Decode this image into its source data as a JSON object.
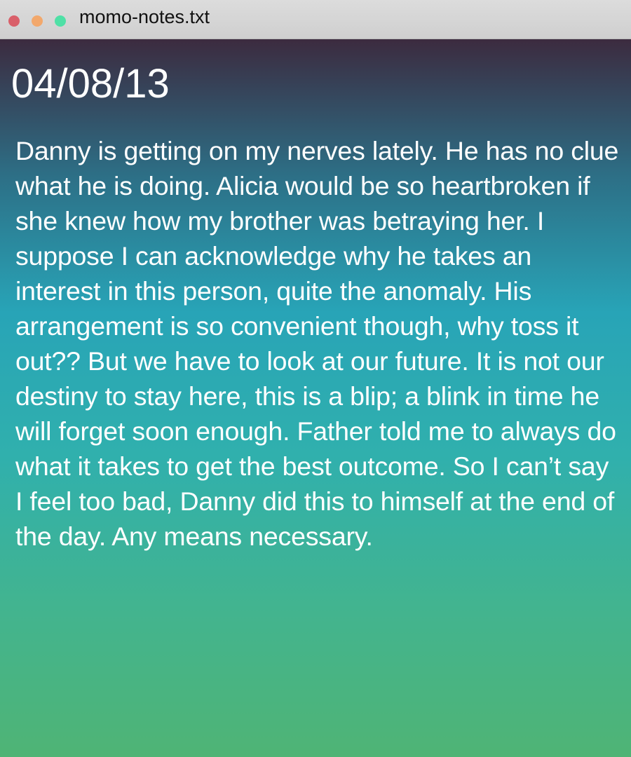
{
  "window": {
    "title": "momo-notes.txt",
    "controls": {
      "close_color": "#d9606a",
      "minimize_color": "#f2a86c",
      "maximize_color": "#4fe0a6"
    }
  },
  "note": {
    "date": "04/08/13",
    "text": "Danny is getting on my nerves lately. He has no clue what he is doing. Alicia would be so heartbroken if she knew how my brother was betraying her. I suppose I can acknowledge why he takes an interest in this person, quite the anomaly. His arrangement is so convenient though, why toss it out?? But we have to look at our future. It is not our destiny to stay here, this is a blip; a blink in time he will forget soon enough. Father told me to always do what it takes to get the best outcome. So I can’t say I feel too bad, Danny did this to himself at the end of the day. Any means necessary."
  }
}
